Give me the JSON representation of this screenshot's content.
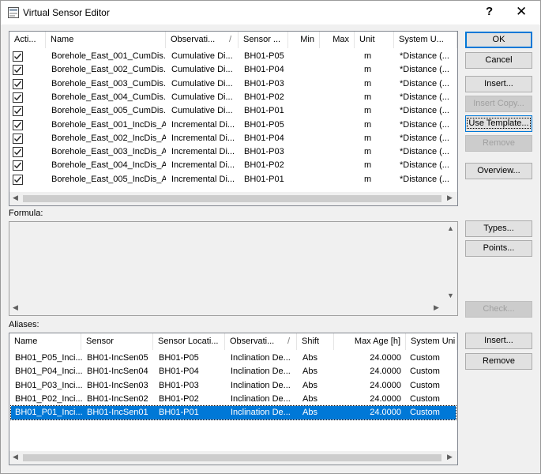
{
  "window": {
    "title": "Virtual Sensor Editor",
    "help_label": "?",
    "close_label": "✕"
  },
  "sensors": {
    "columns": [
      "Acti...",
      "Name",
      "Observati...",
      "/",
      "Sensor ...",
      "Min",
      "Max",
      "Unit",
      "System U..."
    ],
    "rows": [
      {
        "active": true,
        "name": "Borehole_East_001_CumDis...",
        "observation": "Cumulative Di...",
        "sensor": "BH01-P05",
        "min": "",
        "max": "",
        "unit": "m",
        "system_unit": "*Distance (..."
      },
      {
        "active": true,
        "name": "Borehole_East_002_CumDis...",
        "observation": "Cumulative Di...",
        "sensor": "BH01-P04",
        "min": "",
        "max": "",
        "unit": "m",
        "system_unit": "*Distance (..."
      },
      {
        "active": true,
        "name": "Borehole_East_003_CumDis...",
        "observation": "Cumulative Di...",
        "sensor": "BH01-P03",
        "min": "",
        "max": "",
        "unit": "m",
        "system_unit": "*Distance (..."
      },
      {
        "active": true,
        "name": "Borehole_East_004_CumDis...",
        "observation": "Cumulative Di...",
        "sensor": "BH01-P02",
        "min": "",
        "max": "",
        "unit": "m",
        "system_unit": "*Distance (..."
      },
      {
        "active": true,
        "name": "Borehole_East_005_CumDis...",
        "observation": "Cumulative Di...",
        "sensor": "BH01-P01",
        "min": "",
        "max": "",
        "unit": "m",
        "system_unit": "*Distance (..."
      },
      {
        "active": true,
        "name": "Borehole_East_001_IncDis_A",
        "observation": "Incremental Di...",
        "sensor": "BH01-P05",
        "min": "",
        "max": "",
        "unit": "m",
        "system_unit": "*Distance (..."
      },
      {
        "active": true,
        "name": "Borehole_East_002_IncDis_A",
        "observation": "Incremental Di...",
        "sensor": "BH01-P04",
        "min": "",
        "max": "",
        "unit": "m",
        "system_unit": "*Distance (..."
      },
      {
        "active": true,
        "name": "Borehole_East_003_IncDis_A",
        "observation": "Incremental Di...",
        "sensor": "BH01-P03",
        "min": "",
        "max": "",
        "unit": "m",
        "system_unit": "*Distance (..."
      },
      {
        "active": true,
        "name": "Borehole_East_004_IncDis_A",
        "observation": "Incremental Di...",
        "sensor": "BH01-P02",
        "min": "",
        "max": "",
        "unit": "m",
        "system_unit": "*Distance (..."
      },
      {
        "active": true,
        "name": "Borehole_East_005_IncDis_A",
        "observation": "Incremental Di...",
        "sensor": "BH01-P01",
        "min": "",
        "max": "",
        "unit": "m",
        "system_unit": "*Distance (..."
      }
    ]
  },
  "formula": {
    "label": "Formula:",
    "value": ""
  },
  "aliases": {
    "label": "Aliases:",
    "columns": [
      "Name",
      "Sensor",
      "Sensor Locati...",
      "Observati...",
      "/",
      "Shift",
      "Max Age [h]",
      "System Uni"
    ],
    "rows": [
      {
        "name": "BH01_P05_Inci...",
        "sensor": "BH01-IncSen05",
        "location": "BH01-P05",
        "observation": "Inclination De...",
        "shift": "Abs",
        "max_age": "24.0000",
        "system_unit": "Custom",
        "selected": false
      },
      {
        "name": "BH01_P04_Inci...",
        "sensor": "BH01-IncSen04",
        "location": "BH01-P04",
        "observation": "Inclination De...",
        "shift": "Abs",
        "max_age": "24.0000",
        "system_unit": "Custom",
        "selected": false
      },
      {
        "name": "BH01_P03_Inci...",
        "sensor": "BH01-IncSen03",
        "location": "BH01-P03",
        "observation": "Inclination De...",
        "shift": "Abs",
        "max_age": "24.0000",
        "system_unit": "Custom",
        "selected": false
      },
      {
        "name": "BH01_P02_Inci...",
        "sensor": "BH01-IncSen02",
        "location": "BH01-P02",
        "observation": "Inclination De...",
        "shift": "Abs",
        "max_age": "24.0000",
        "system_unit": "Custom",
        "selected": false
      },
      {
        "name": "BH01_P01_Inci...",
        "sensor": "BH01-IncSen01",
        "location": "BH01-P01",
        "observation": "Inclination De...",
        "shift": "Abs",
        "max_age": "24.0000",
        "system_unit": "Custom",
        "selected": true
      }
    ]
  },
  "buttons": {
    "ok": "OK",
    "cancel": "Cancel",
    "insert": "Insert...",
    "insert_copy": "Insert Copy...",
    "use_template": "Use Template...",
    "remove": "Remove",
    "overview": "Overview...",
    "types": "Types...",
    "points": "Points...",
    "check": "Check...",
    "alias_insert": "Insert...",
    "alias_remove": "Remove"
  },
  "colors": {
    "selection": "#0078d7",
    "accent": "#0078d7"
  }
}
